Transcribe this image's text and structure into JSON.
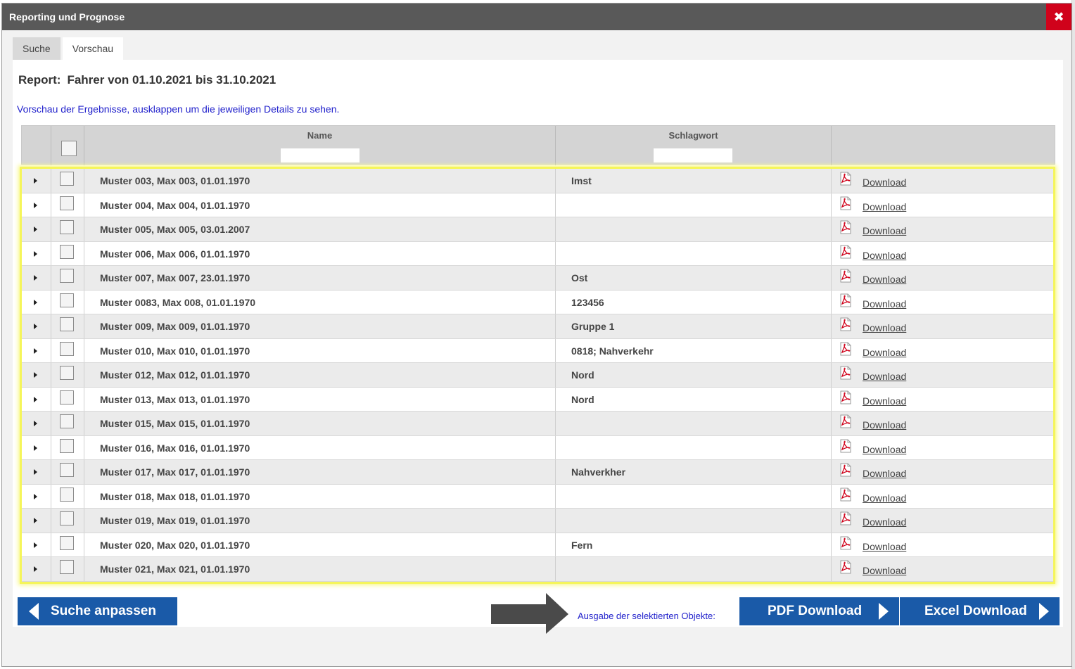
{
  "window": {
    "title": "Reporting und Prognose",
    "close_glyph": "✖"
  },
  "tabs": [
    {
      "label": "Suche",
      "active": false
    },
    {
      "label": "Vorschau",
      "active": true
    }
  ],
  "report": {
    "label": "Report:",
    "title": "Fahrer von 01.10.2021 bis 31.10.2021",
    "hint": "Vorschau der Ergebnisse, ausklappen um die jeweiligen Details zu sehen."
  },
  "table": {
    "columns": {
      "name": "Name",
      "schlagwort": "Schlagwort"
    },
    "download_label": "Download",
    "rows": [
      {
        "name": "Muster 003, Max 003, 01.01.1970",
        "schlagwort": "Imst"
      },
      {
        "name": "Muster 004, Max 004, 01.01.1970",
        "schlagwort": ""
      },
      {
        "name": "Muster 005, Max 005, 03.01.2007",
        "schlagwort": ""
      },
      {
        "name": "Muster 006, Max 006, 01.01.1970",
        "schlagwort": ""
      },
      {
        "name": "Muster 007, Max 007, 23.01.1970",
        "schlagwort": "Ost"
      },
      {
        "name": "Muster 0083, Max 008, 01.01.1970",
        "schlagwort": "123456"
      },
      {
        "name": "Muster 009, Max 009, 01.01.1970",
        "schlagwort": "Gruppe 1"
      },
      {
        "name": "Muster 010, Max 010, 01.01.1970",
        "schlagwort": "0818; Nahverkehr"
      },
      {
        "name": "Muster 012, Max 012, 01.01.1970",
        "schlagwort": "Nord"
      },
      {
        "name": "Muster 013, Max 013, 01.01.1970",
        "schlagwort": "Nord"
      },
      {
        "name": "Muster 015, Max 015, 01.01.1970",
        "schlagwort": ""
      },
      {
        "name": "Muster 016, Max 016, 01.01.1970",
        "schlagwort": ""
      },
      {
        "name": "Muster 017, Max 017, 01.01.1970",
        "schlagwort": "Nahverkher"
      },
      {
        "name": "Muster 018, Max 018, 01.01.1970",
        "schlagwort": ""
      },
      {
        "name": "Muster 019, Max 019, 01.01.1970",
        "schlagwort": ""
      },
      {
        "name": "Muster 020, Max 020, 01.01.1970",
        "schlagwort": "Fern"
      },
      {
        "name": "Muster 021, Max 021, 01.01.1970",
        "schlagwort": ""
      }
    ]
  },
  "footer": {
    "back_button": "Suche anpassen",
    "output_label": "Ausgabe der selektierten Objekte:",
    "pdf_button": "PDF Download",
    "excel_button": "Excel Download"
  },
  "colors": {
    "titlebar": "#595959",
    "close": "#d0021b",
    "button": "#1a5aa8",
    "highlight": "#f5f55a",
    "link_blue": "#2222cc"
  }
}
